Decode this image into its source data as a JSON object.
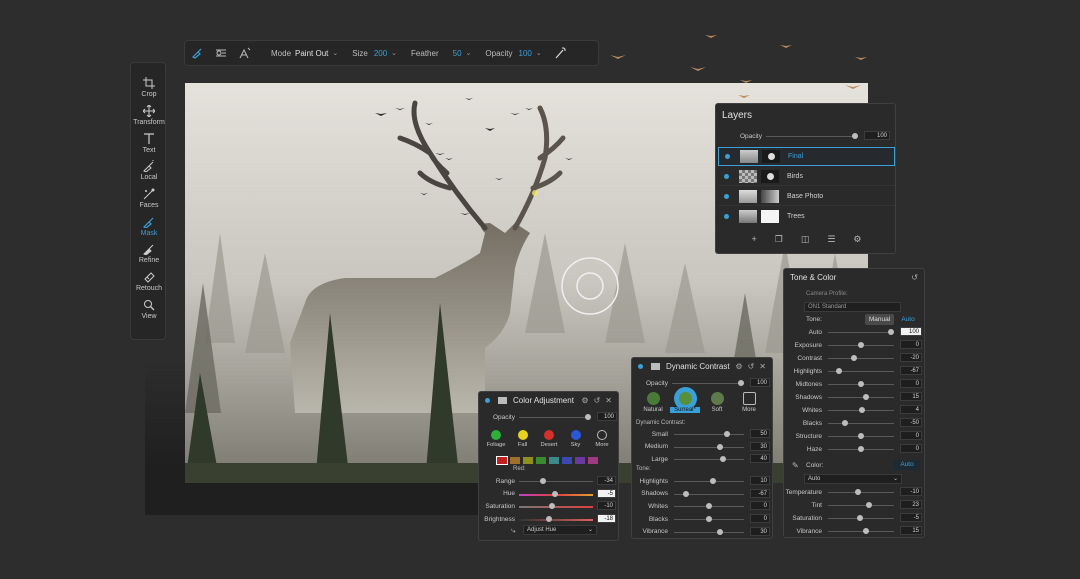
{
  "toolbar": {
    "mode_label": "Mode",
    "mode_value": "Paint Out",
    "size_label": "Size",
    "size_value": "200",
    "feather_label": "Feather",
    "feather_value": "50",
    "opacity_label": "Opacity",
    "opacity_value": "100"
  },
  "sidebar": {
    "items": [
      {
        "label": "Crop",
        "icon": "crop-icon"
      },
      {
        "label": "Transform",
        "icon": "transform-icon"
      },
      {
        "label": "Text",
        "icon": "text-icon"
      },
      {
        "label": "Local",
        "icon": "local-brush-icon"
      },
      {
        "label": "Faces",
        "icon": "faces-icon"
      },
      {
        "label": "Mask",
        "icon": "mask-brush-icon"
      },
      {
        "label": "Refine",
        "icon": "refine-brush-icon"
      },
      {
        "label": "Retouch",
        "icon": "retouch-icon"
      },
      {
        "label": "View",
        "icon": "view-zoom-icon"
      }
    ],
    "active_index": 5
  },
  "layers": {
    "title": "Layers",
    "opacity_label": "Opacity",
    "opacity_value": "100",
    "items": [
      {
        "name": "Final"
      },
      {
        "name": "Birds"
      },
      {
        "name": "Base Photo"
      },
      {
        "name": "Trees"
      }
    ],
    "selected_index": 0
  },
  "tone_color": {
    "title": "Tone & Color",
    "camera_profile_label": "Camera Profile:",
    "camera_profile_value": "ON1 Standard",
    "tone_label": "Tone:",
    "manual_label": "Manual",
    "auto_label": "Auto",
    "sliders": [
      {
        "label": "Auto",
        "value": "100",
        "pos": 0.95
      },
      {
        "label": "Exposure",
        "value": "0",
        "pos": 0.5
      },
      {
        "label": "Contrast",
        "value": "-20",
        "pos": 0.4
      },
      {
        "label": "Highlights",
        "value": "-67",
        "pos": 0.17
      },
      {
        "label": "Midtones",
        "value": "0",
        "pos": 0.5
      },
      {
        "label": "Shadows",
        "value": "15",
        "pos": 0.57
      },
      {
        "label": "Whites",
        "value": "4",
        "pos": 0.52
      },
      {
        "label": "Blacks",
        "value": "-50",
        "pos": 0.25
      },
      {
        "label": "Structure",
        "value": "0",
        "pos": 0.5
      },
      {
        "label": "Haze",
        "value": "0",
        "pos": 0.5
      }
    ],
    "color_label": "Color:",
    "color_auto": "Auto",
    "color_select": "Auto",
    "color_sliders": [
      {
        "label": "Temperature",
        "value": "-10",
        "pos": 0.45
      },
      {
        "label": "Tint",
        "value": "23",
        "pos": 0.62
      },
      {
        "label": "Saturation",
        "value": "-5",
        "pos": 0.48
      },
      {
        "label": "Vibrance",
        "value": "15",
        "pos": 0.57
      }
    ]
  },
  "dynamic_contrast": {
    "title": "Dynamic Contrast",
    "opacity_label": "Opacity",
    "opacity_value": "100",
    "presets": [
      "Natural",
      "Surreal*",
      "Soft",
      "More"
    ],
    "selected_preset": 1,
    "dc_label": "Dynamic Contrast:",
    "dc_sliders": [
      {
        "label": "Small",
        "value": "50",
        "pos": 0.75
      },
      {
        "label": "Medium",
        "value": "30",
        "pos": 0.65
      },
      {
        "label": "Large",
        "value": "40",
        "pos": 0.7
      }
    ],
    "tone_label": "Tone:",
    "tone_sliders": [
      {
        "label": "Highlights",
        "value": "10",
        "pos": 0.55
      },
      {
        "label": "Shadows",
        "value": "-67",
        "pos": 0.17
      },
      {
        "label": "Whites",
        "value": "0",
        "pos": 0.5
      },
      {
        "label": "Blacks",
        "value": "0",
        "pos": 0.5
      },
      {
        "label": "Vibrance",
        "value": "30",
        "pos": 0.65
      }
    ]
  },
  "color_adjustment": {
    "title": "Color Adjustment",
    "opacity_label": "Opacity",
    "opacity_value": "100",
    "colors": [
      {
        "label": "Foliage",
        "color": "#2fae3a"
      },
      {
        "label": "Fall",
        "color": "#e9d21e"
      },
      {
        "label": "Desert",
        "color": "#d6302a"
      },
      {
        "label": "Sky",
        "color": "#2a58d6"
      },
      {
        "label": "More",
        "color": "#bbbbbb"
      }
    ],
    "swatches": [
      "#c02020",
      "#a0702a",
      "#909020",
      "#3a8a30",
      "#3a8a8a",
      "#3a4ab0",
      "#6a3aa0",
      "#a03a80"
    ],
    "swatch_selected_label": "Red:",
    "sliders": [
      {
        "label": "Range",
        "value": "-34",
        "pos": 0.33
      },
      {
        "label": "Hue",
        "value": "-5",
        "pos": 0.48,
        "white": true
      },
      {
        "label": "Saturation",
        "value": "-10",
        "pos": 0.45
      },
      {
        "label": "Brightness",
        "value": "-18",
        "pos": 0.4,
        "white": true
      }
    ],
    "adjust_select": "Adjust Hue"
  }
}
